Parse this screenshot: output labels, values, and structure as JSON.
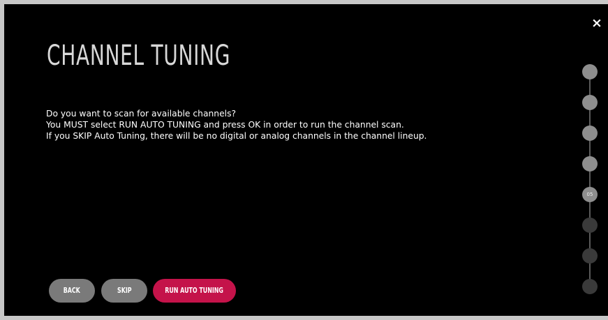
{
  "window": {
    "close_label": "×"
  },
  "page": {
    "title": "CHANNEL TUNING",
    "description_lines": [
      "Do you want to scan for available channels?",
      "You MUST select RUN AUTO TUNING and press OK in order to run the channel scan.",
      "If you SKIP Auto Tuning, there will be no digital or analog channels in the channel lineup."
    ]
  },
  "buttons": {
    "back_label": "BACK",
    "skip_label": "SKIP",
    "run_label": "RUN AUTO TUNING"
  },
  "progress": {
    "total_steps": 8,
    "current_step": 5,
    "current_label": "05"
  },
  "colors": {
    "background": "#000000",
    "accent": "#c4134a",
    "button_grey": "#7a7a7a",
    "step_done": "#8e8e8e",
    "step_todo": "#3a3a3a"
  }
}
